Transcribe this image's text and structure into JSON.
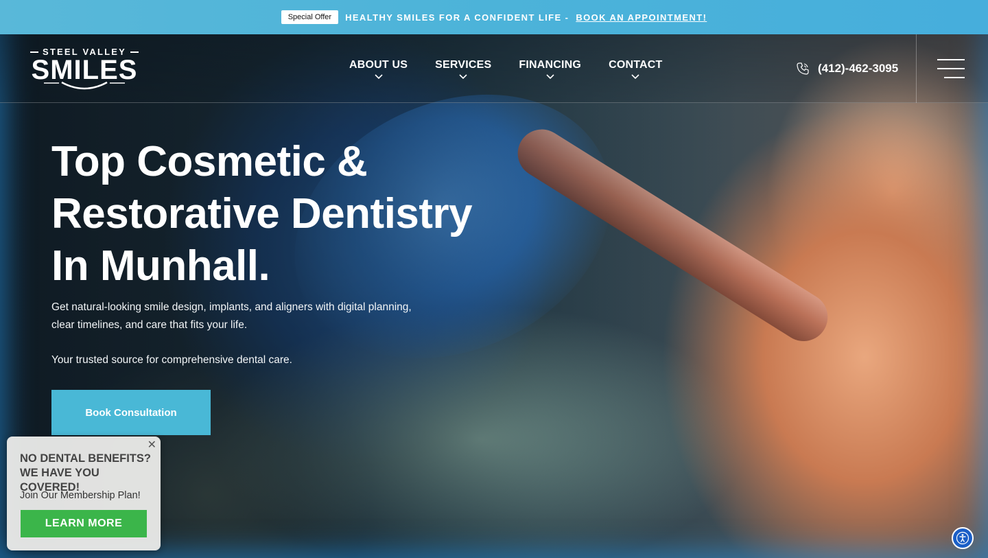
{
  "topbar": {
    "badge": "Special Offer",
    "message": "HEALTHY SMILES FOR A CONFIDENT LIFE - ",
    "link": "BOOK AN APPOINTMENT!"
  },
  "logo": {
    "top": "STEEL VALLEY",
    "main": "SMILES"
  },
  "nav": {
    "items": [
      {
        "label": "ABOUT US"
      },
      {
        "label": "SERVICES"
      },
      {
        "label": "FINANCING"
      },
      {
        "label": "CONTACT"
      }
    ]
  },
  "phone": {
    "number": "(412)-462-3095",
    "icon": "phone-icon"
  },
  "hero": {
    "title_line1": "Top Cosmetic &",
    "title_line2": "Restorative Dentistry",
    "title_line3": "In Munhall.",
    "subtitle": "Get natural-looking smile design, implants, and aligners with digital planning, clear timelines, and care that fits your life.",
    "subtitle2": "Your trusted source for comprehensive dental care.",
    "cta": "Book Consultation"
  },
  "promo": {
    "close": "✕",
    "heading_line1": "NO DENTAL BENEFITS?",
    "heading_line2": "WE HAVE YOU COVERED!",
    "subtext": "Join Our Membership Plan!",
    "button": "LEARN MORE"
  },
  "colors": {
    "topbar": "#4cb3d9",
    "cta": "#49b8d6",
    "promo_button": "#3bb54a",
    "accessibility": "#1b5fc7"
  }
}
